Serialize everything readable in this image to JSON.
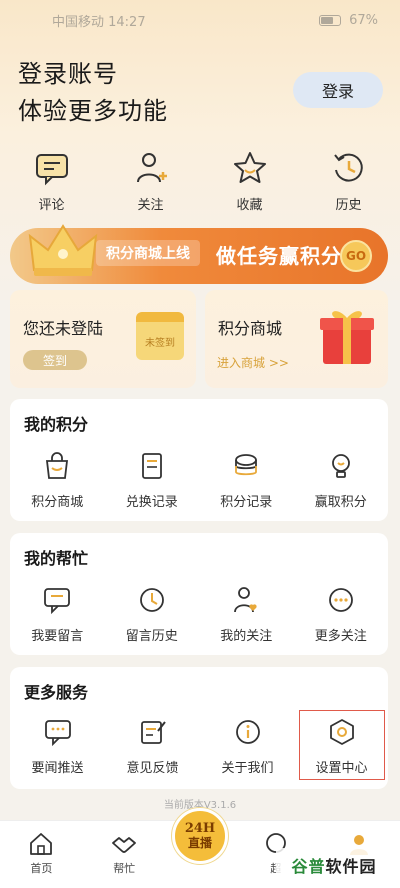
{
  "status": {
    "carrier_time": "中国移动 14:27",
    "battery": "67%"
  },
  "header": {
    "line1": "登录账号",
    "line2": "体验更多功能",
    "login_button": "登录"
  },
  "quick_actions": [
    {
      "label": "评论",
      "icon": "comment-icon"
    },
    {
      "label": "关注",
      "icon": "follow-user-icon"
    },
    {
      "label": "收藏",
      "icon": "star-icon"
    },
    {
      "label": "历史",
      "icon": "history-icon"
    }
  ],
  "banner": {
    "tag": "积分商城上线",
    "text": "做任务赢积分",
    "go": "GO"
  },
  "checkin_card": {
    "title": "您还未登陆",
    "button": "签到",
    "calendar_text": "未签到"
  },
  "mall_card": {
    "title": "积分商城",
    "link": "进入商城 >>"
  },
  "sections": {
    "points": {
      "title": "我的积分",
      "items": [
        "积分商城",
        "兑换记录",
        "积分记录",
        "赢取积分"
      ]
    },
    "help": {
      "title": "我的帮忙",
      "items": [
        "我要留言",
        "留言历史",
        "我的关注",
        "更多关注"
      ]
    },
    "services": {
      "title": "更多服务",
      "items": [
        "要闻推送",
        "意见反馈",
        "关于我们",
        "设置中心"
      ]
    }
  },
  "version": "当前版本V3.1.6",
  "tabbar": {
    "items": [
      "首页",
      "帮忙",
      "超"
    ],
    "live_line1": "24H",
    "live_line2": "直播"
  },
  "watermark": {
    "part1": "谷普",
    "part2": "软件园"
  },
  "colors": {
    "accent": "#f08a3b",
    "gold": "#f4bd3a",
    "highlight_border": "#e05a4a"
  }
}
